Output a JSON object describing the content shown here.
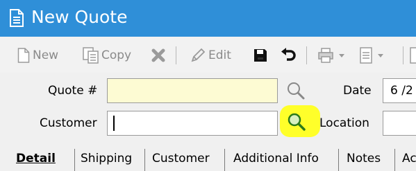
{
  "window": {
    "title": "New Quote",
    "title_bar_color": "#2f8fd8"
  },
  "toolbar": {
    "new_label": "New",
    "copy_label": "Copy",
    "edit_label": "Edit"
  },
  "form": {
    "quote_label": "Quote #",
    "quote_value": "",
    "date_label": "Date",
    "date_value": "6 /2",
    "customer_label": "Customer",
    "customer_value": "",
    "location_label": "Location",
    "location_value": "",
    "required_field_color": "#fdfbd3",
    "highlight_color": "#ffff2a"
  },
  "tabs": [
    {
      "label": "Detail",
      "active": true
    },
    {
      "label": "Shipping"
    },
    {
      "label": "Customer"
    },
    {
      "label": "Additional Info"
    },
    {
      "label": "Notes"
    },
    {
      "label": "Ac"
    }
  ]
}
